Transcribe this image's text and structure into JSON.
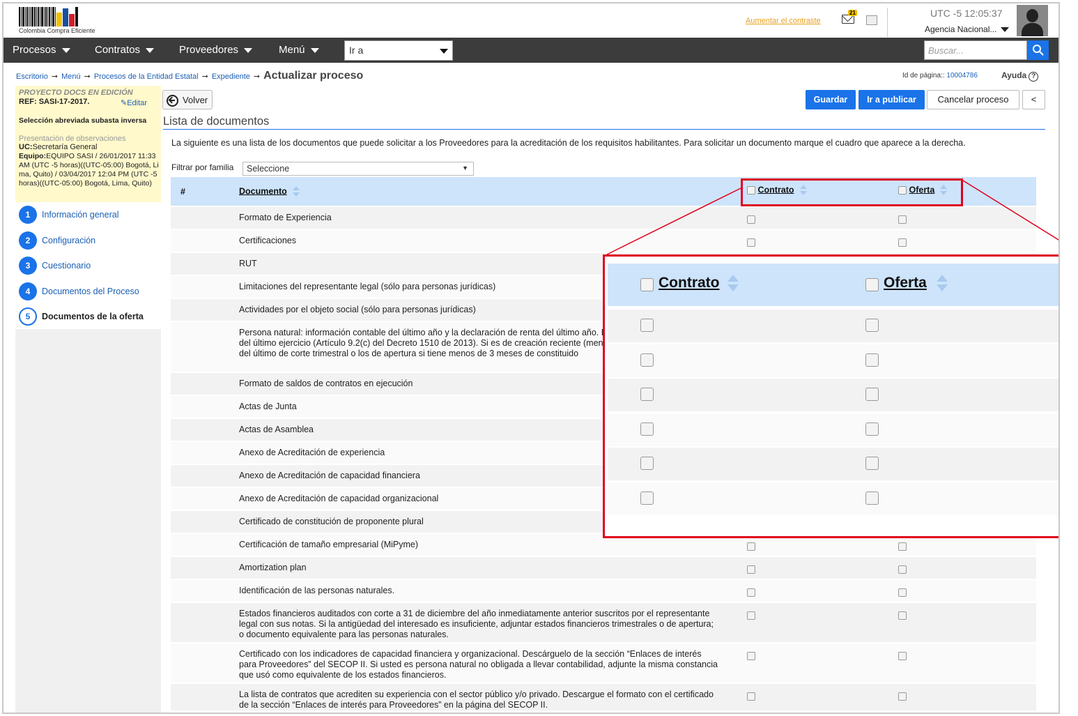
{
  "header": {
    "logo_text": "Colombia Compra Eficiente",
    "contrast_link": "Aumentar el contraste",
    "mail_count": "21",
    "time": "UTC -5 12:05:37",
    "agency": "Agencia Nacional..."
  },
  "navbar": {
    "items": [
      "Procesos",
      "Contratos",
      "Proveedores",
      "Menú"
    ],
    "goto_value": "Ir a",
    "search_placeholder": "Buscar..."
  },
  "breadcrumb": {
    "items": [
      "Escritorio",
      "Menú",
      "Procesos de la Entidad Estatal",
      "Expediente"
    ],
    "current": "Actualizar proceso",
    "page_id_label": "Id de página::",
    "page_id": "10004786",
    "help": "Ayuda"
  },
  "sidebar": {
    "project_status": "PROYECTO DOCS EN EDICIÓN",
    "ref": "REF: SASI-17-2017.",
    "edit_label": "Editar",
    "selection": "Selección abreviada subasta inversa",
    "phase": "Presentación de observaciones",
    "uc_label": "UC:",
    "uc_value": "Secretaría General",
    "team_label": "Equipo:",
    "team_value": "EQUIPO SASI / 26/01/2017 11:33 AM (UTC -5 horas)((UTC-05:00) Bogotá, Lima, Quito) / 03/04/2017 12:04 PM (UTC -5 horas)((UTC-05:00) Bogotá, Lima, Quito)",
    "steps": [
      {
        "num": "1",
        "label": "Información general"
      },
      {
        "num": "2",
        "label": "Configuración"
      },
      {
        "num": "3",
        "label": "Cuestionario"
      },
      {
        "num": "4",
        "label": "Documentos del Proceso"
      },
      {
        "num": "5",
        "label": "Documentos de la oferta"
      }
    ]
  },
  "toolbar": {
    "back": "Volver",
    "save": "Guardar",
    "publish": "Ir a publicar",
    "cancel": "Cancelar proceso",
    "collapse": "<"
  },
  "main": {
    "section_title": "Lista de documentos",
    "intro": "La siguiente es una lista de los documentos que puede solicitar a los Proveedores para la acreditación de los requisitos habilitantes. Para solicitar un documento marque el cuadro que aparece a la derecha.",
    "filter_label": "Filtrar por familia",
    "filter_value": "Seleccione"
  },
  "table": {
    "columns": [
      "#",
      "Documento",
      "Contrato",
      "Oferta"
    ],
    "rows": [
      "Formato de Experiencia",
      "Certificaciones",
      "RUT",
      "Limitaciones del representante legal (sólo para personas jurídicas)",
      "Actividades por el objeto social (sólo para personas jurídicas)",
      "Persona natural: información contable del último año y la declaración de renta del último año. Estados financieros auditados del último ejercicio (Artículo 9.2(c) del Decreto 1510 de 2013). Si es de creación reciente (menos de 1 año) deben ser los del último de corte trimestral o los de apertura si tiene menos de 3 meses de constituido",
      "Formato de saldos de contratos en ejecución",
      "Actas de Junta",
      "Actas de Asamblea",
      "Anexo de Acreditación de experiencia",
      "Anexo de Acreditación de capacidad financiera",
      "Anexo de Acreditación de capacidad organizacional",
      "Certificado de constitución de proponente plural",
      "Certificación de tamaño empresarial (MiPyme)",
      "Amortization plan",
      "Identificación de las personas naturales.",
      "Estados financieros auditados con corte a 31 de diciembre del año inmediatamente anterior suscritos por el representante legal con sus notas. Si la antigüedad del interesado es insuficiente, adjuntar estados financieros trimestrales o de apertura; o documento equivalente para las personas naturales.",
      "Certificado con los indicadores de capacidad financiera y organizacional. Descárguelo de la sección “Enlaces de interés para Proveedores” del SECOP II. Si usted es persona natural no obligada a llevar contabilidad, adjunte la misma constancia que usó como equivalente de los estados financieros.",
      "La lista de contratos que acrediten su experiencia con el sector público y/o privado. Descargue el formato con el certificado de la sección “Enlaces de interés para Proveedores” en la página del SECOP II."
    ]
  },
  "zoom": {
    "contrato": "Contrato",
    "oferta": "Oferta"
  },
  "colors": {
    "accent": "#1a73e8",
    "highlight": "#e0001a",
    "navbar": "#3c3c3c",
    "table_header": "#cde4fb",
    "sidebar_info": "#fff9cc"
  }
}
